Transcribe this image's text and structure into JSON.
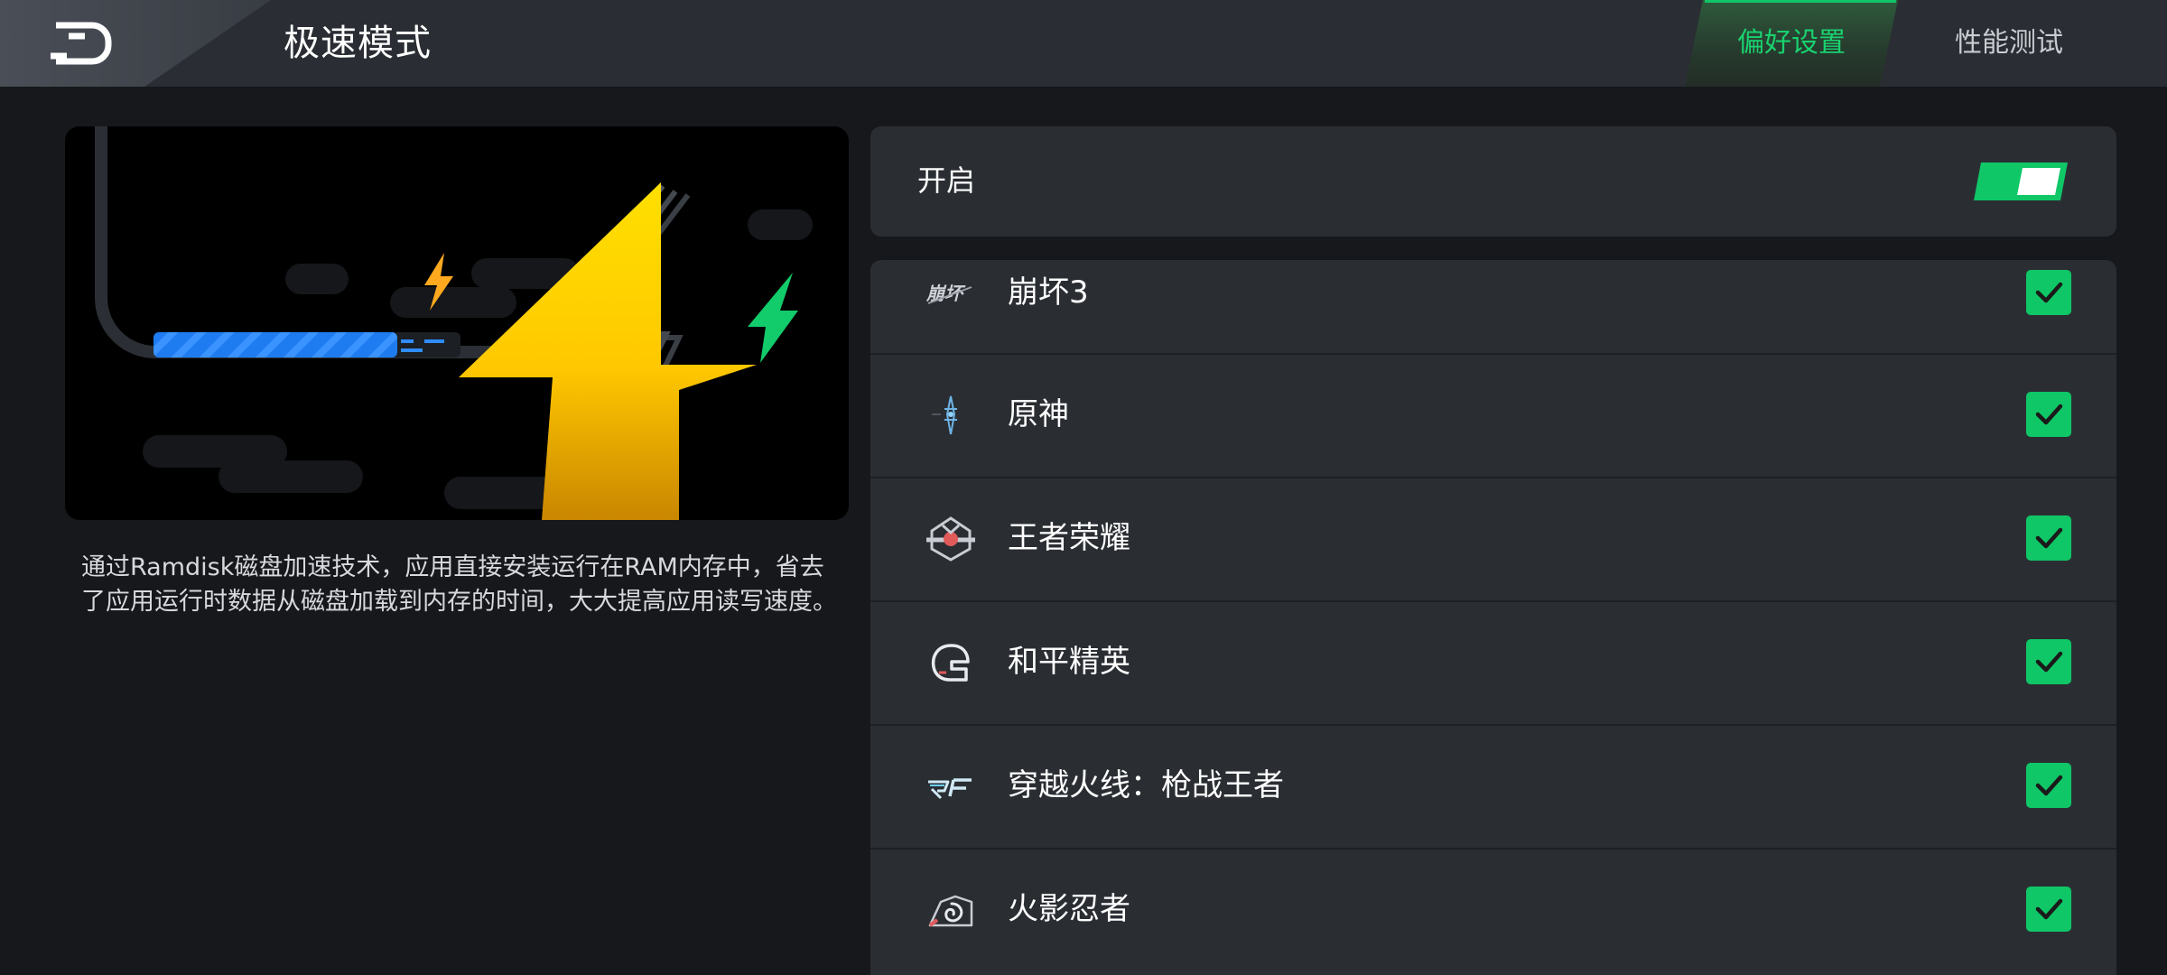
{
  "header": {
    "title": "极速模式",
    "tabs": [
      {
        "label": "偏好设置",
        "active": true
      },
      {
        "label": "性能测试",
        "active": false
      }
    ]
  },
  "description": "通过Ramdisk磁盘加速技术，应用直接安装运行在RAM内存中，省去了应用运行时数据从磁盘加载到内存的时间，大大提高应用读写速度。",
  "toggle": {
    "label": "开启",
    "on": true
  },
  "apps": [
    {
      "name": "崩坏3",
      "checked": true,
      "icon": "honkai-icon"
    },
    {
      "name": "原神",
      "checked": true,
      "icon": "genshin-icon"
    },
    {
      "name": "王者荣耀",
      "checked": true,
      "icon": "honor-of-kings-icon"
    },
    {
      "name": "和平精英",
      "checked": true,
      "icon": "peacekeeper-elite-icon"
    },
    {
      "name": "穿越火线：枪战王者",
      "checked": true,
      "icon": "crossfire-icon"
    },
    {
      "name": "火影忍者",
      "checked": true,
      "icon": "naruto-icon"
    }
  ],
  "colors": {
    "accent": "#0fc766",
    "tab_active": "#19d26f",
    "background": "#16181c",
    "card": "#2a2e33"
  }
}
